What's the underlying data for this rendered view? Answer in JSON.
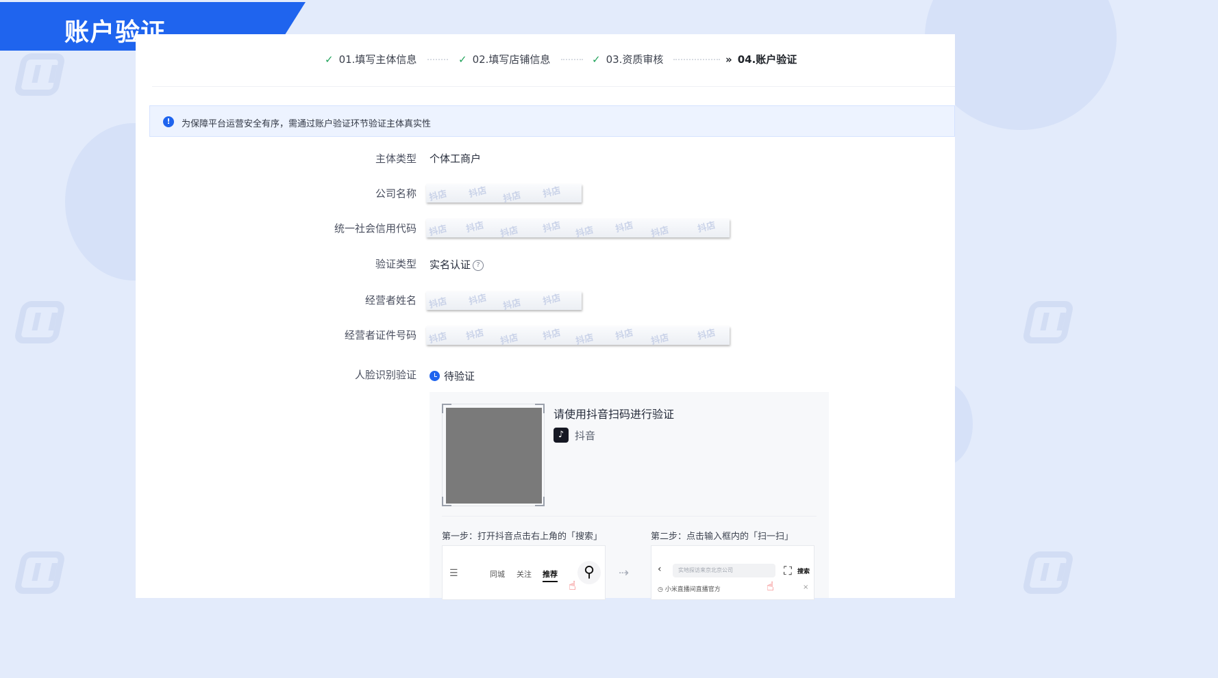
{
  "banner": {
    "title": "账户验证"
  },
  "steps": [
    {
      "label": "01.填写主体信息",
      "status": "done"
    },
    {
      "label": "02.填写店铺信息",
      "status": "done"
    },
    {
      "label": "03.资质审核",
      "status": "done"
    },
    {
      "label": "04.账户验证",
      "status": "current"
    }
  ],
  "notice": {
    "text": "为保障平台运营安全有序，需通过账户验证环节验证主体真实性"
  },
  "form": {
    "entity_type": {
      "label": "主体类型",
      "value": "个体工商户"
    },
    "company_name": {
      "label": "公司名称"
    },
    "credit_code": {
      "label": "统一社会信用代码"
    },
    "verify_type": {
      "label": "验证类型",
      "value": "实名认证"
    },
    "operator_name": {
      "label": "经营者姓名"
    },
    "operator_id": {
      "label": "经营者证件号码"
    },
    "face_verify": {
      "label": "人脸识别验证",
      "status": "待验证"
    }
  },
  "watermark_text": "抖店",
  "qr_panel": {
    "title": "请使用抖音扫码进行验证",
    "app_name": "抖音",
    "step1": "第一步：打开抖音点击右上角的「搜索」",
    "step2": "第二步：点击输入框内的「扫一扫」"
  },
  "phone1": {
    "tabs": [
      "同城",
      "关注",
      "推荐"
    ]
  },
  "phone2": {
    "placeholder": "实地探访来京北京公司",
    "search_btn": "搜索",
    "suggestion": "小米直播间直播官方"
  },
  "colors": {
    "accent": "#1f64ee",
    "check": "#21a35b",
    "background": "#e3ebfb"
  }
}
